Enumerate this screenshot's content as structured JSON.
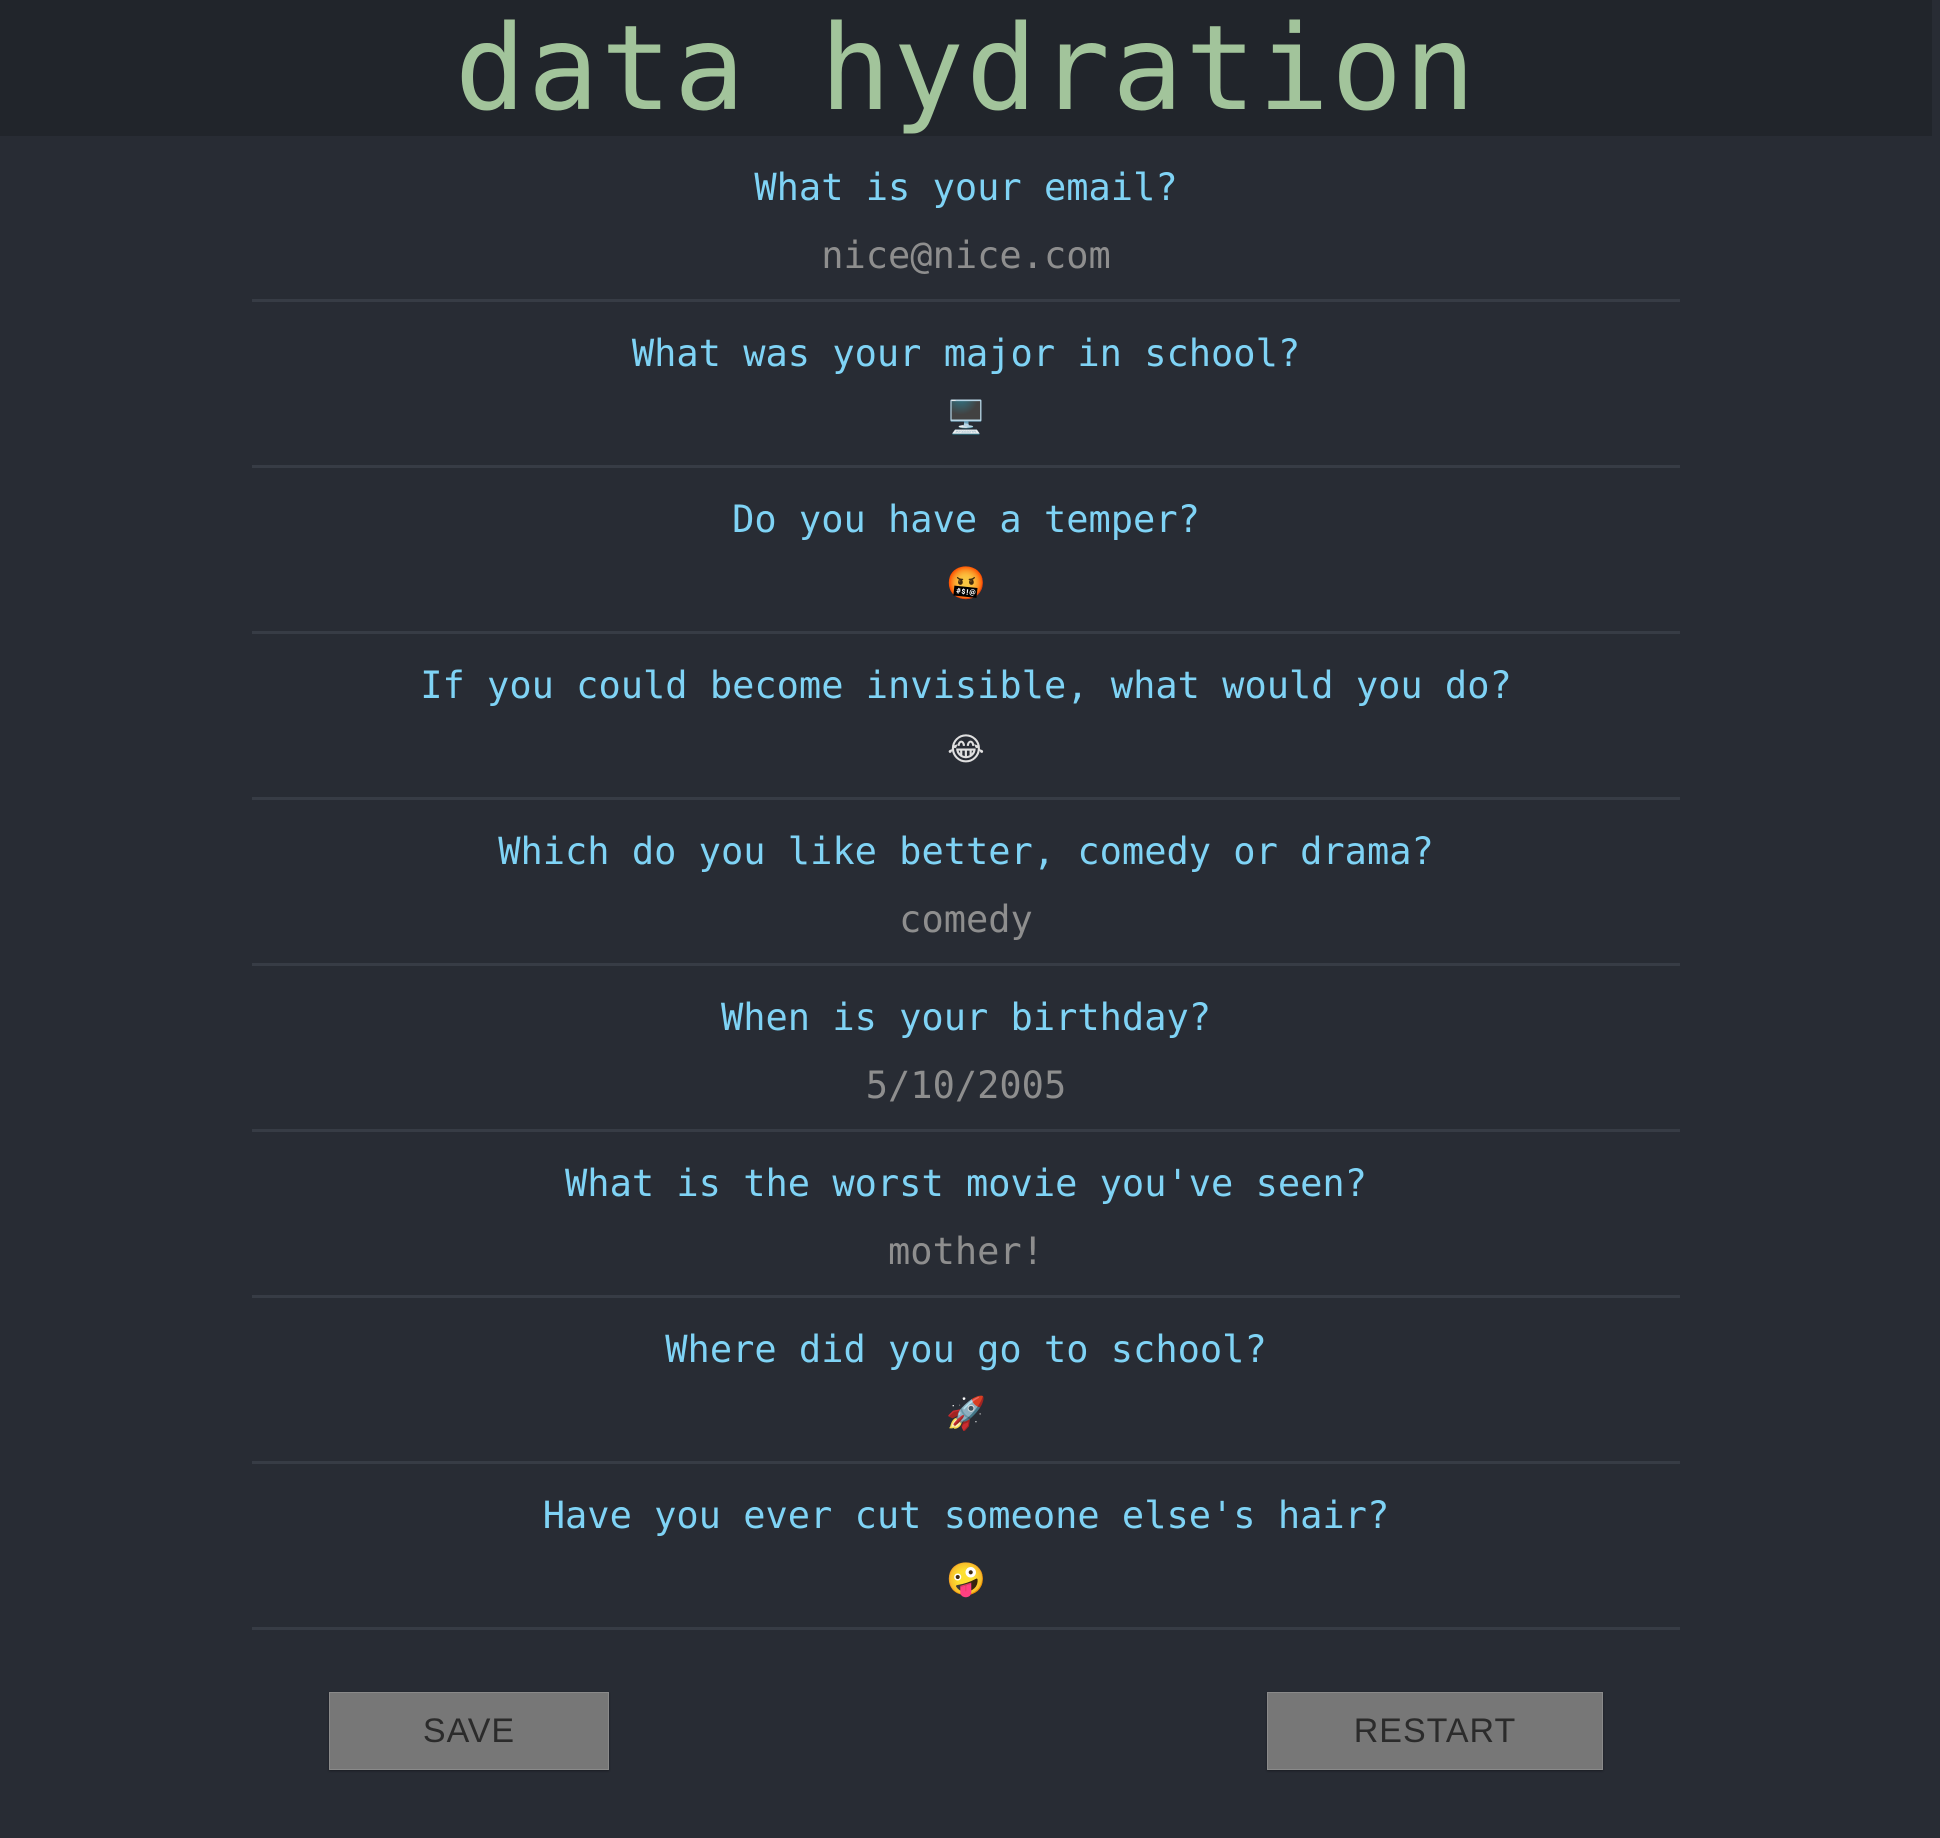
{
  "header": {
    "title": "data hydration"
  },
  "questions": [
    {
      "question": "What is your email?",
      "answer": "nice@nice.com",
      "kind": "text"
    },
    {
      "question": "What was your major in school?",
      "answer": "🖥️",
      "kind": "emoji",
      "icon": "desktop-computer-icon"
    },
    {
      "question": "Do you have a temper?",
      "answer": "🤬",
      "kind": "emoji",
      "icon": "cursing-face-icon"
    },
    {
      "question": "If you could become invisible, what would you do?",
      "answer": "😂",
      "kind": "emoji",
      "icon": "tears-of-joy-icon"
    },
    {
      "question": "Which do you like better, comedy or drama?",
      "answer": "comedy",
      "kind": "text"
    },
    {
      "question": "When is your birthday?",
      "answer": "5/10/2005",
      "kind": "text"
    },
    {
      "question": "What is the worst movie you've seen?",
      "answer": "mother!",
      "kind": "text"
    },
    {
      "question": "Where did you go to school?",
      "answer": "🚀",
      "kind": "emoji",
      "icon": "rocket-icon"
    },
    {
      "question": "Have you ever cut someone else's hair?",
      "answer": "🤪",
      "kind": "emoji",
      "icon": "zany-face-icon"
    }
  ],
  "buttons": {
    "save": "SAVE",
    "restart": "RESTART"
  },
  "colors": {
    "header_bg": "#21252b",
    "page_bg": "#282c34",
    "title": "#a2c49b",
    "question": "#7fd3f5",
    "answer": "#8e8e8e",
    "button_bg": "#777777"
  }
}
